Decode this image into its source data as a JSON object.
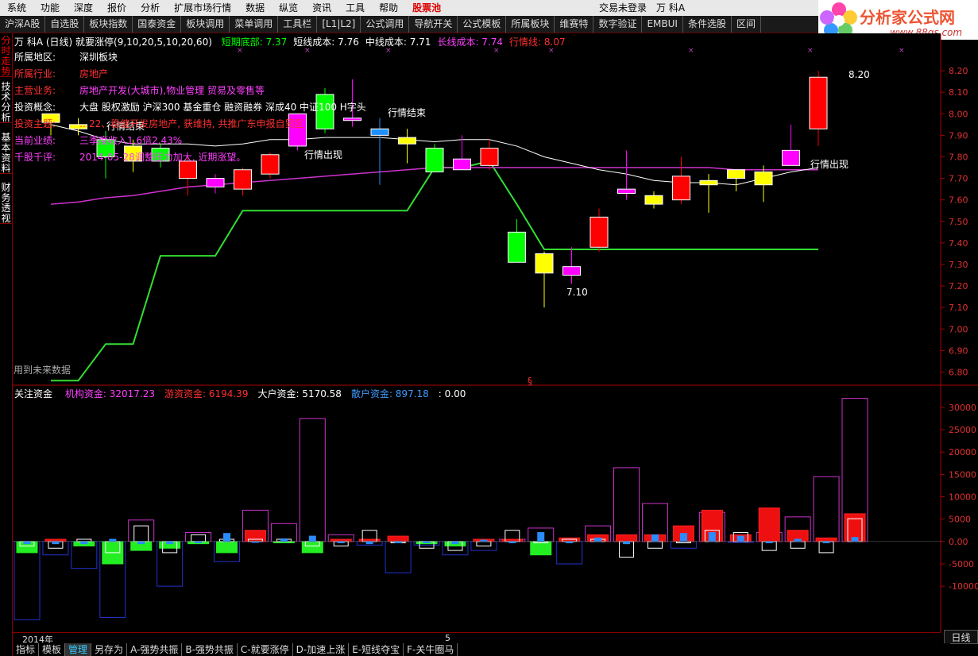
{
  "menubar": {
    "items": [
      "系统",
      "功能",
      "深度",
      "报价",
      "分析",
      "扩展市场行情",
      "数据",
      "纵览",
      "资讯",
      "工具",
      "帮助",
      "股票池"
    ],
    "status": "交易未登录",
    "stock_short": "万 科A"
  },
  "toolbar": {
    "items": [
      "沪深A股",
      "自选股",
      "板块指数",
      "国泰资金",
      "板块调用",
      "菜单调用",
      "工具栏",
      "[L1|L2]",
      "公式调用",
      "导航开关",
      "公式模板",
      "所属板块",
      "维赛特",
      "数字验证",
      "EMBUI",
      "条件选股",
      "区间"
    ]
  },
  "logo": {
    "title": "分析家公式网",
    "url": "www.88gs.com"
  },
  "sidetabs": [
    "分时走势",
    "技术分析",
    "基本资料",
    "财务透视"
  ],
  "main_header": {
    "stock": "万 科A (日线) 就要涨停(9,10,20,5,10,20,60)",
    "items": [
      {
        "label": "短期底部: 7.37",
        "color": "#00ff00"
      },
      {
        "label": "短线成本: 7.76",
        "color": "#ffffff"
      },
      {
        "label": "中线成本: 7.71",
        "color": "#ffffff"
      },
      {
        "label": "长线成本: 7.74",
        "color": "#ff40ff"
      },
      {
        "label": "行情线: 8.07",
        "color": "#ff3030"
      }
    ]
  },
  "info": [
    {
      "label": "所属地区:",
      "value": "深圳板块",
      "lcolor": "#ffffff",
      "vcolor": "#ffffff"
    },
    {
      "label": "所属行业:",
      "value": "房地产",
      "lcolor": "#ff3030",
      "vcolor": "#ff3030"
    },
    {
      "label": "主营业务:",
      "value": "房地产开发(大城市),物业管理 贸易及零售等",
      "lcolor": "#ff3030",
      "vcolor": "#ff40ff"
    },
    {
      "label": "投资概念:",
      "value": "大盘 股权激励 沪深300 基金重仓 融资融券 深成40 中证100 H字头",
      "lcolor": "#ffffff",
      "vcolor": "#ffffff"
    },
    {
      "label": "投资主题:",
      "value": "…22、稳健开发房地产, 获维持, 共推广东申报自贸区",
      "lcolor": "#ff3030",
      "vcolor": "#ff3030"
    },
    {
      "label": "当前业绩:",
      "value": "三季度收入1.6倍2.43%",
      "lcolor": "#ff40ff",
      "vcolor": "#ff40ff"
    },
    {
      "label": "千股千评:",
      "value": "2014-05-28调整压力加大, 近期涨望。",
      "lcolor": "#ff40ff",
      "vcolor": "#ff40ff"
    }
  ],
  "annotations": {
    "signal_end_1": "行情结束",
    "signal_out_1": "行情出现",
    "signal_end_2": "行情结束",
    "signal_out_2": "行情出现",
    "high_label": "8.20",
    "low_label": "7.10",
    "future_label": "用到未来数据",
    "section_mark": "§"
  },
  "price_axis": [
    "8.20",
    "8.10",
    "8.00",
    "7.90",
    "7.80",
    "7.70",
    "7.60",
    "7.50",
    "7.40",
    "7.30",
    "7.20",
    "7.10",
    "7.00",
    "6.90",
    "6.80"
  ],
  "sub_header": {
    "title": "关注资金",
    "items": [
      {
        "label": "机构资金: 32017.23",
        "color": "#ff40ff"
      },
      {
        "label": "游资资金: 6194.39",
        "color": "#ff3030"
      },
      {
        "label": "大户资金: 5170.58",
        "color": "#ffffff"
      },
      {
        "label": "散户资金: 897.18",
        "color": "#3c9cff"
      },
      {
        "label": ": 0.00",
        "color": "#ffffff"
      }
    ]
  },
  "sub_axis": [
    "30000",
    "25000",
    "20000",
    "15000",
    "10000",
    "5000",
    "0.00",
    "-5000",
    "-10000"
  ],
  "time_axis": {
    "year": "2014年",
    "month": "5"
  },
  "period": "日线",
  "bottom_tabs": [
    "指标",
    "模板",
    "管理",
    "另存为",
    "A-强势共振",
    "B-强势共振",
    "C-就要涨停",
    "D-加速上涨",
    "E-短线夺宝",
    "F-关牛圈马"
  ],
  "chart_data": {
    "type": "candlestick",
    "candles": [
      {
        "o": 7.96,
        "h": 8.0,
        "l": 7.9,
        "c": 8.0,
        "color": "yellow"
      },
      {
        "o": 7.95,
        "h": 7.98,
        "l": 7.9,
        "c": 7.93,
        "color": "yellow"
      },
      {
        "o": 7.88,
        "h": 7.92,
        "l": 7.7,
        "c": 7.8,
        "color": "green"
      },
      {
        "o": 7.85,
        "h": 7.88,
        "l": 7.73,
        "c": 7.78,
        "color": "yellow"
      },
      {
        "o": 7.84,
        "h": 7.86,
        "l": 7.75,
        "c": 7.78,
        "color": "green"
      },
      {
        "o": 7.7,
        "h": 7.8,
        "l": 7.62,
        "c": 7.78,
        "color": "red"
      },
      {
        "o": 7.66,
        "h": 7.72,
        "l": 7.63,
        "c": 7.7,
        "color": "magenta"
      },
      {
        "o": 7.65,
        "h": 7.75,
        "l": 7.62,
        "c": 7.74,
        "color": "red"
      },
      {
        "o": 7.72,
        "h": 7.82,
        "l": 7.7,
        "c": 7.81,
        "color": "red"
      },
      {
        "o": 7.85,
        "h": 8.0,
        "l": 7.83,
        "c": 8.0,
        "color": "magenta"
      },
      {
        "o": 8.09,
        "h": 8.12,
        "l": 7.91,
        "c": 7.93,
        "color": "green"
      },
      {
        "o": 7.98,
        "h": 8.16,
        "l": 7.94,
        "c": 7.98,
        "color": "magenta"
      },
      {
        "o": 7.93,
        "h": 7.98,
        "l": 7.67,
        "c": 7.9,
        "color": "blue"
      },
      {
        "o": 7.89,
        "h": 7.93,
        "l": 7.77,
        "c": 7.86,
        "color": "yellow"
      },
      {
        "o": 7.84,
        "h": 7.86,
        "l": 7.73,
        "c": 7.73,
        "color": "green"
      },
      {
        "o": 7.79,
        "h": 7.9,
        "l": 7.76,
        "c": 7.74,
        "color": "magenta"
      },
      {
        "o": 7.76,
        "h": 7.88,
        "l": 7.74,
        "c": 7.84,
        "color": "red"
      },
      {
        "o": 7.45,
        "h": 7.51,
        "l": 7.32,
        "c": 7.31,
        "color": "green"
      },
      {
        "o": 7.35,
        "h": 7.36,
        "l": 7.1,
        "c": 7.26,
        "color": "yellow"
      },
      {
        "o": 7.29,
        "h": 7.38,
        "l": 7.21,
        "c": 7.25,
        "color": "magenta"
      },
      {
        "o": 7.38,
        "h": 7.56,
        "l": 7.36,
        "c": 7.52,
        "color": "red"
      },
      {
        "o": 7.65,
        "h": 7.83,
        "l": 7.6,
        "c": 7.63,
        "color": "magenta"
      },
      {
        "o": 7.62,
        "h": 7.64,
        "l": 7.56,
        "c": 7.58,
        "color": "yellow"
      },
      {
        "o": 7.6,
        "h": 7.8,
        "l": 7.58,
        "c": 7.71,
        "color": "red"
      },
      {
        "o": 7.69,
        "h": 7.72,
        "l": 7.54,
        "c": 7.67,
        "color": "yellow"
      },
      {
        "o": 7.7,
        "h": 7.74,
        "l": 7.64,
        "c": 7.74,
        "color": "yellow"
      },
      {
        "o": 7.73,
        "h": 7.76,
        "l": 7.59,
        "c": 7.67,
        "color": "yellow"
      },
      {
        "o": 7.83,
        "h": 7.95,
        "l": 7.77,
        "c": 7.76,
        "color": "magenta"
      },
      {
        "o": 7.93,
        "h": 8.2,
        "l": 7.85,
        "c": 8.17,
        "color": "red"
      }
    ],
    "ma_white": [
      7.95,
      7.92,
      7.88,
      7.86,
      7.86,
      7.86,
      7.85,
      7.86,
      7.88,
      7.88,
      7.89,
      7.89,
      7.89,
      7.88,
      7.87,
      7.88,
      7.88,
      7.85,
      7.8,
      7.77,
      7.74,
      7.72,
      7.69,
      7.68,
      7.68,
      7.67,
      7.7,
      7.73,
      7.75
    ],
    "ma_magenta": [
      7.58,
      7.59,
      7.61,
      7.62,
      7.64,
      7.66,
      7.67,
      7.68,
      7.69,
      7.7,
      7.71,
      7.72,
      7.73,
      7.74,
      7.75,
      7.75,
      7.75,
      7.75,
      7.75,
      7.75,
      7.75,
      7.75,
      7.75,
      7.75,
      7.75,
      7.74,
      7.74,
      7.74,
      7.74
    ],
    "support_green": [
      6.76,
      6.76,
      6.93,
      6.93,
      7.34,
      7.34,
      7.34,
      7.55,
      7.55,
      7.55,
      7.55,
      7.55,
      7.55,
      7.55,
      7.75,
      7.75,
      7.78,
      7.58,
      7.37,
      7.37,
      7.37,
      7.37,
      7.37,
      7.37,
      7.37,
      7.37,
      7.37,
      7.37,
      7.37
    ],
    "ylim": [
      6.75,
      8.3
    ],
    "funds": [
      {
        "inst": -17500,
        "hot": -2500,
        "big": -1000,
        "retail": -500
      },
      {
        "inst": -3000,
        "hot": 500,
        "big": -1500,
        "retail": -500
      },
      {
        "inst": -6000,
        "hot": -1000,
        "big": 500,
        "retail": -500
      },
      {
        "inst": -17000,
        "hot": -5000,
        "big": -2500,
        "retail": 500
      },
      {
        "inst": 4800,
        "hot": -2000,
        "big": 3500,
        "retail": -500
      },
      {
        "inst": -10000,
        "hot": -1500,
        "big": -2500,
        "retail": -500
      },
      {
        "inst": 2000,
        "hot": -500,
        "big": 1500,
        "retail": -300
      },
      {
        "inst": -4500,
        "hot": -2500,
        "big": 500,
        "retail": 1800
      },
      {
        "inst": 7000,
        "hot": 2500,
        "big": 500,
        "retail": -200
      },
      {
        "inst": 4000,
        "hot": -300,
        "big": 500,
        "retail": 600
      },
      {
        "inst": 27500,
        "hot": -2500,
        "big": -1000,
        "retail": 1200
      },
      {
        "inst": 1500,
        "hot": 500,
        "big": -1000,
        "retail": -300
      },
      {
        "inst": -800,
        "hot": 500,
        "big": 2500,
        "retail": -500
      },
      {
        "inst": -7000,
        "hot": 1200,
        "big": -300,
        "retail": -300
      },
      {
        "inst": -800,
        "hot": -500,
        "big": -1500,
        "retail": -300
      },
      {
        "inst": -3000,
        "hot": -1000,
        "big": -2000,
        "retail": -500
      },
      {
        "inst": -2000,
        "hot": 500,
        "big": -1000,
        "retail": 300
      },
      {
        "inst": 500,
        "hot": 500,
        "big": 2500,
        "retail": -300
      },
      {
        "inst": 3000,
        "hot": -3000,
        "big": -300,
        "retail": 2000
      },
      {
        "inst": -5000,
        "hot": 800,
        "big": 500,
        "retail": -300
      },
      {
        "inst": 3500,
        "hot": 1500,
        "big": 500,
        "retail": 800
      },
      {
        "inst": 16500,
        "hot": 1500,
        "big": -3500,
        "retail": -500
      },
      {
        "inst": 8500,
        "hot": 1500,
        "big": -1500,
        "retail": 1500
      },
      {
        "inst": -1500,
        "hot": 3500,
        "big": -300,
        "retail": 1800
      },
      {
        "inst": 6500,
        "hot": 7000,
        "big": 2500,
        "retail": 2000
      },
      {
        "inst": -200,
        "hot": 1500,
        "big": 2000,
        "retail": 1200
      },
      {
        "inst": 2000,
        "hot": 7500,
        "big": -2000,
        "retail": -300
      },
      {
        "inst": 5500,
        "hot": 2500,
        "big": -1500,
        "retail": 500
      },
      {
        "inst": 14500,
        "hot": 800,
        "big": -2500,
        "retail": -300
      },
      {
        "inst": 32000,
        "hot": 6200,
        "big": 5100,
        "retail": 900
      }
    ],
    "funds_ylim": [
      -18500,
      33000
    ]
  }
}
